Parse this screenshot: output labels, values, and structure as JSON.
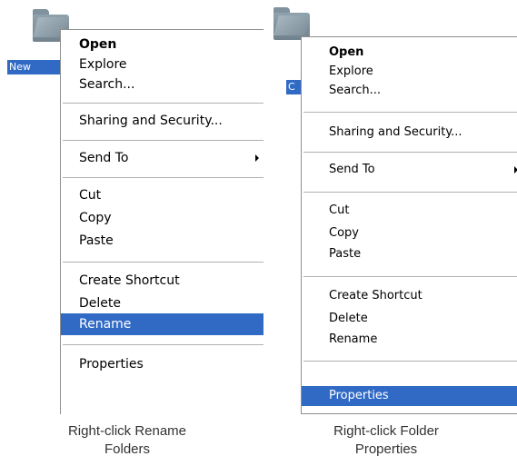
{
  "left": {
    "folder_label": "New",
    "menu_items": {
      "open": "Open",
      "explore": "Explore",
      "search": "Search...",
      "sharing": "Sharing and Security...",
      "send_to": "Send To",
      "cut": "Cut",
      "copy": "Copy",
      "paste": "Paste",
      "create_shortcut": "Create Shortcut",
      "delete": "Delete",
      "rename": "Rename",
      "properties": "Properties"
    },
    "highlighted": "Rename",
    "caption_line1": "Right-click Rename",
    "caption_line2": "Folders"
  },
  "right": {
    "folder_label": "C",
    "menu_items": {
      "open": "Open",
      "explore": "Explore",
      "search": "Search...",
      "sharing": "Sharing and Security...",
      "send_to": "Send To",
      "cut": "Cut",
      "copy": "Copy",
      "paste": "Paste",
      "create_shortcut": "Create Shortcut",
      "delete": "Delete",
      "rename": "Rename",
      "properties": "Properties"
    },
    "highlighted": "Properties",
    "caption_line1": "Right-click Folder",
    "caption_line2": "Properties"
  },
  "colors": {
    "highlight": "#316ac5",
    "menu_border": "#8e8f8f",
    "folder": "#7f929e"
  },
  "icons": {
    "folder": "folder-icon",
    "submenu": "submenu-arrow-icon"
  }
}
